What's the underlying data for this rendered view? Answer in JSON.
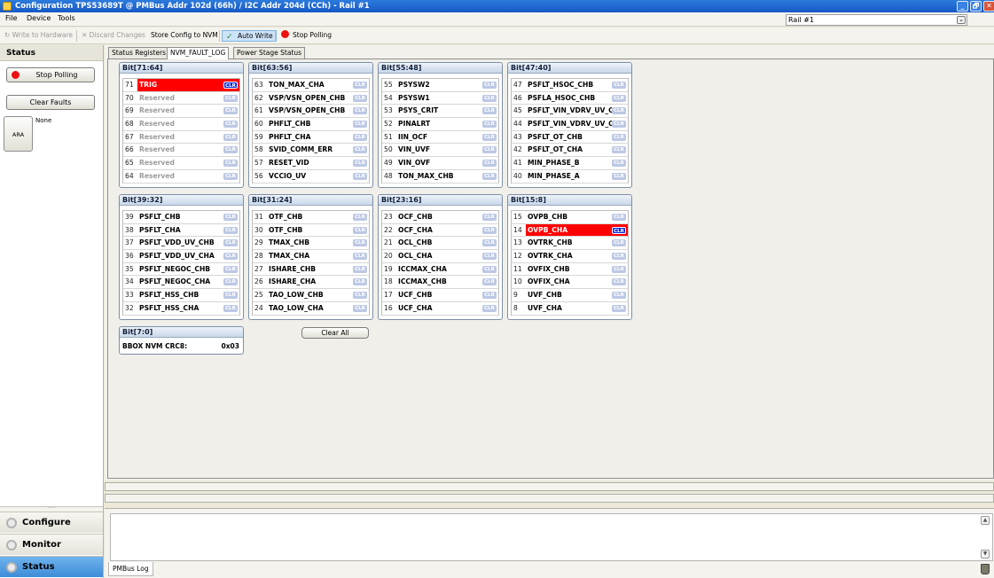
{
  "window": {
    "title": "Configuration TPS53689T @ PMBus Addr 102d (66h) / I2C Addr 204d (CCh) - Rail #1",
    "minimize": "_",
    "maximize": "🗗",
    "close": "✕"
  },
  "menu": {
    "file": "File",
    "device": "Device",
    "tools": "Tools"
  },
  "rail_select": {
    "value": "Rail #1",
    "arrow": "⌄"
  },
  "toolbar": {
    "write_to_hardware": "Write to Hardware",
    "discard_changes": "Discard Changes",
    "store_config": "Store Config to NVM",
    "auto_write": "Auto Write",
    "stop_polling": "Stop Polling"
  },
  "left": {
    "status_title": "Status",
    "stop_polling": "Stop Polling",
    "clear_faults": "Clear Faults",
    "ara": "ARA",
    "ara_value": "None",
    "nav": {
      "configure": "Configure",
      "monitor": "Monitor",
      "status": "Status"
    }
  },
  "tabs": {
    "status_registers": "Status Registers",
    "nvm_fault_log": "NVM_FAULT_LOG",
    "power_stage_status": "Power Stage Status"
  },
  "clr_label": "CLR",
  "groups": [
    {
      "title": "Bit[71:64]",
      "rows": [
        {
          "num": "71",
          "name": "TRIG",
          "fault": true
        },
        {
          "num": "70",
          "name": "Reserved",
          "reserved": true
        },
        {
          "num": "69",
          "name": "Reserved",
          "reserved": true
        },
        {
          "num": "68",
          "name": "Reserved",
          "reserved": true
        },
        {
          "num": "67",
          "name": "Reserved",
          "reserved": true
        },
        {
          "num": "66",
          "name": "Reserved",
          "reserved": true
        },
        {
          "num": "65",
          "name": "Reserved",
          "reserved": true
        },
        {
          "num": "64",
          "name": "Reserved",
          "reserved": true
        }
      ]
    },
    {
      "title": "Bit[63:56]",
      "rows": [
        {
          "num": "63",
          "name": "TON_MAX_CHA"
        },
        {
          "num": "62",
          "name": "VSP/VSN_OPEN_CHB"
        },
        {
          "num": "61",
          "name": "VSP/VSN_OPEN_CHB"
        },
        {
          "num": "60",
          "name": "PHFLT_CHB"
        },
        {
          "num": "59",
          "name": "PHFLT_CHA"
        },
        {
          "num": "58",
          "name": "SVID_COMM_ERR"
        },
        {
          "num": "57",
          "name": "RESET_VID"
        },
        {
          "num": "56",
          "name": "VCCIO_UV"
        }
      ]
    },
    {
      "title": "Bit[55:48]",
      "rows": [
        {
          "num": "55",
          "name": "PSYSW2"
        },
        {
          "num": "54",
          "name": "PSYSW1"
        },
        {
          "num": "53",
          "name": "PSYS_CRIT"
        },
        {
          "num": "52",
          "name": "PINALRT"
        },
        {
          "num": "51",
          "name": "IIN_OCF"
        },
        {
          "num": "50",
          "name": "VIN_UVF"
        },
        {
          "num": "49",
          "name": "VIN_OVF"
        },
        {
          "num": "48",
          "name": "TON_MAX_CHB"
        }
      ]
    },
    {
      "title": "Bit[47:40]",
      "rows": [
        {
          "num": "47",
          "name": "PSFLT_HSOC_CHB"
        },
        {
          "num": "46",
          "name": "PSFLA_HSOC_CHB"
        },
        {
          "num": "45",
          "name": "PSFLT_VIN_VDRV_UV_C"
        },
        {
          "num": "44",
          "name": "PSFLT_VIN_VDRV_UV_C"
        },
        {
          "num": "43",
          "name": "PSFLT_OT_CHB"
        },
        {
          "num": "42",
          "name": "PSFLT_OT_CHA"
        },
        {
          "num": "41",
          "name": "MIN_PHASE_B"
        },
        {
          "num": "40",
          "name": "MIN_PHASE_A"
        }
      ]
    },
    {
      "title": "Bit[39:32]",
      "rows": [
        {
          "num": "39",
          "name": "PSFLT_CHB"
        },
        {
          "num": "38",
          "name": "PSFLT_CHA"
        },
        {
          "num": "37",
          "name": "PSFLT_VDD_UV_CHB"
        },
        {
          "num": "36",
          "name": "PSFLT_VDD_UV_CHA"
        },
        {
          "num": "35",
          "name": "PSFLT_NEGOC_CHB"
        },
        {
          "num": "34",
          "name": "PSFLT_NEGOC_CHA"
        },
        {
          "num": "33",
          "name": "PSFLT_HSS_CHB"
        },
        {
          "num": "32",
          "name": "PSFLT_HSS_CHA"
        }
      ]
    },
    {
      "title": "Bit[31:24]",
      "rows": [
        {
          "num": "31",
          "name": "OTF_CHB"
        },
        {
          "num": "30",
          "name": "OTF_CHB"
        },
        {
          "num": "29",
          "name": "TMAX_CHB"
        },
        {
          "num": "28",
          "name": "TMAX_CHA"
        },
        {
          "num": "27",
          "name": "ISHARE_CHB"
        },
        {
          "num": "26",
          "name": "ISHARE_CHA"
        },
        {
          "num": "25",
          "name": "TAO_LOW_CHB"
        },
        {
          "num": "24",
          "name": "TAO_LOW_CHA"
        }
      ]
    },
    {
      "title": "Bit[23:16]",
      "rows": [
        {
          "num": "23",
          "name": "OCF_CHB"
        },
        {
          "num": "22",
          "name": "OCF_CHA"
        },
        {
          "num": "21",
          "name": "OCL_CHB"
        },
        {
          "num": "20",
          "name": "OCL_CHA"
        },
        {
          "num": "19",
          "name": "ICCMAX_CHA"
        },
        {
          "num": "18",
          "name": "ICCMAX_CHB"
        },
        {
          "num": "17",
          "name": "UCF_CHB"
        },
        {
          "num": "16",
          "name": "UCF_CHA"
        }
      ]
    },
    {
      "title": "Bit[15:8]",
      "rows": [
        {
          "num": "15",
          "name": "OVPB_CHB"
        },
        {
          "num": "14",
          "name": "OVPB_CHA",
          "fault": true
        },
        {
          "num": "13",
          "name": "OVTRK_CHB"
        },
        {
          "num": "12",
          "name": "OVTRK_CHA"
        },
        {
          "num": "11",
          "name": "OVFIX_CHB"
        },
        {
          "num": "10",
          "name": "OVFIX_CHA"
        },
        {
          "num": "9",
          "name": "UVF_CHB"
        },
        {
          "num": "8",
          "name": "UVF_CHA"
        }
      ]
    }
  ],
  "crc": {
    "title": "Bit[7:0]",
    "label": "BBOX NVM CRC8:",
    "value": "0x03"
  },
  "clear_all": "Clear All",
  "log": {
    "tab": "PMBus Log",
    "up": "▲",
    "down": "▼"
  },
  "colors": {
    "fault": "#ff0000",
    "clr_active": "#0a2ad8",
    "clr_inactive": "#bcc8e4",
    "nav_active": "#3e8cd7"
  }
}
